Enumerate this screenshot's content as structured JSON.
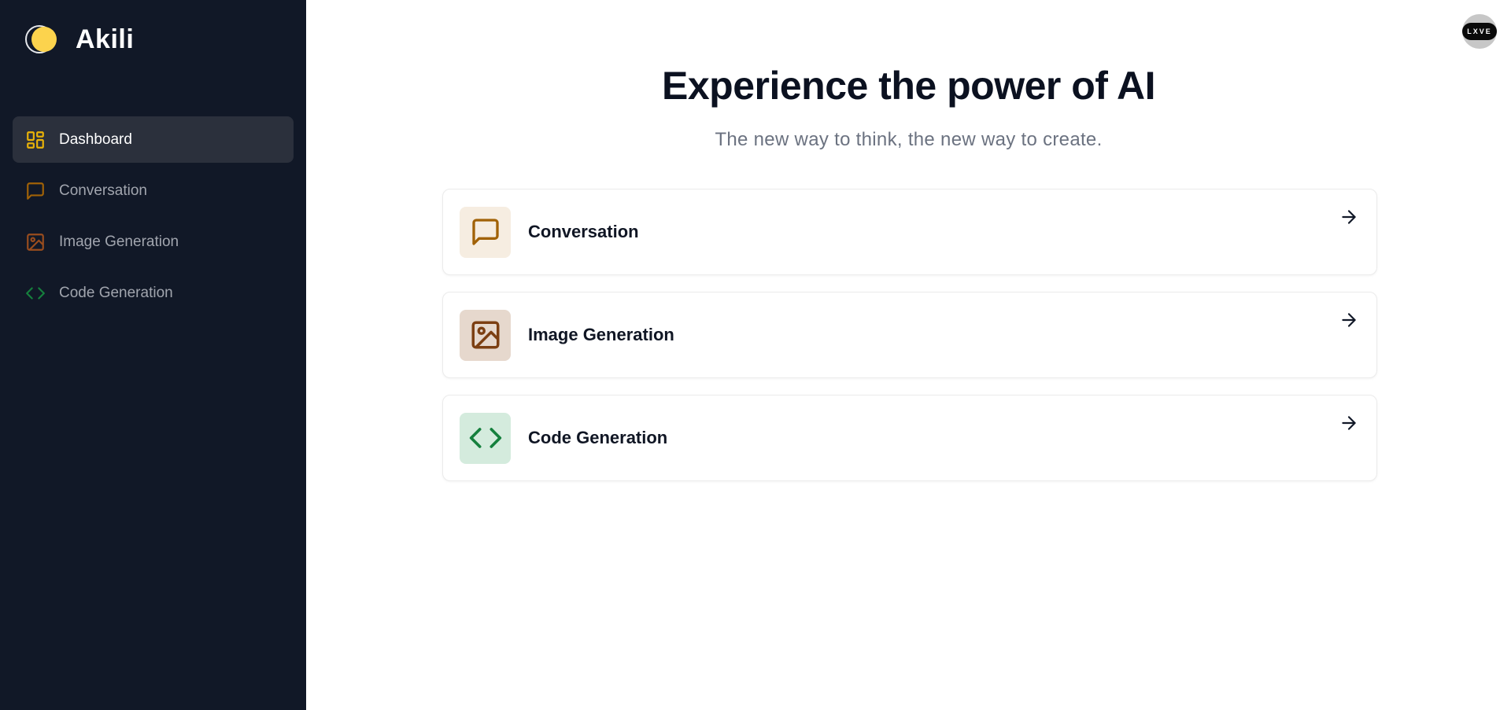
{
  "brand": {
    "name": "Akili"
  },
  "sidebar": {
    "items": [
      {
        "label": "Dashboard",
        "icon": "dashboard-icon",
        "color": "#eab308",
        "active": true
      },
      {
        "label": "Conversation",
        "icon": "message-square-icon",
        "color": "#a16207",
        "active": false
      },
      {
        "label": "Image Generation",
        "icon": "image-icon",
        "color": "#9a4d1e",
        "active": false
      },
      {
        "label": "Code Generation",
        "icon": "code-icon",
        "color": "#15803d",
        "active": false
      }
    ]
  },
  "header": {
    "avatar_text": "LXVE"
  },
  "hero": {
    "title": "Experience the power of AI",
    "subtitle": "The new way to think, the new way to create."
  },
  "cards": [
    {
      "label": "Conversation",
      "icon": "message-square-icon",
      "icon_color": "#a16207",
      "bg_color": "#f6ede1"
    },
    {
      "label": "Image Generation",
      "icon": "image-icon",
      "icon_color": "#7c3f12",
      "bg_color": "#e6d8cd"
    },
    {
      "label": "Code Generation",
      "icon": "code-icon",
      "icon_color": "#15803d",
      "bg_color": "#d4ebdd"
    }
  ],
  "colors": {
    "sidebar_bg": "#111827",
    "active_item_bg": "#2b303c"
  }
}
